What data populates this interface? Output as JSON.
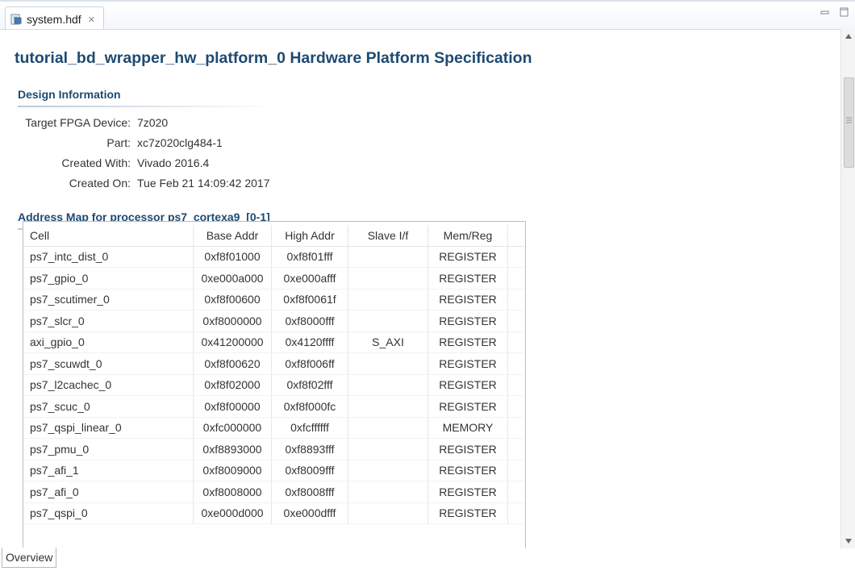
{
  "tab": {
    "filename": "system.hdf",
    "close_glyph": "✕"
  },
  "page": {
    "title": "tutorial_bd_wrapper_hw_platform_0 Hardware Platform Specification"
  },
  "design_info": {
    "heading": "Design Information",
    "rows": [
      {
        "label": "Target FPGA Device:",
        "value": "7z020"
      },
      {
        "label": "Part:",
        "value": "xc7z020clg484-1"
      },
      {
        "label": "Created With:",
        "value": "Vivado 2016.4"
      },
      {
        "label": "Created On:",
        "value": "Tue Feb 21 14:09:42 2017"
      }
    ]
  },
  "address_map": {
    "heading": "Address Map for processor ps7_cortexa9_[0-1]",
    "columns": {
      "cell": "Cell",
      "base": "Base Addr",
      "high": "High Addr",
      "slave": "Slave I/f",
      "mem": "Mem/Reg"
    },
    "rows": [
      {
        "cell": "ps7_intc_dist_0",
        "base": "0xf8f01000",
        "high": "0xf8f01fff",
        "slave": "",
        "mem": "REGISTER"
      },
      {
        "cell": "ps7_gpio_0",
        "base": "0xe000a000",
        "high": "0xe000afff",
        "slave": "",
        "mem": "REGISTER"
      },
      {
        "cell": "ps7_scutimer_0",
        "base": "0xf8f00600",
        "high": "0xf8f0061f",
        "slave": "",
        "mem": "REGISTER"
      },
      {
        "cell": "ps7_slcr_0",
        "base": "0xf8000000",
        "high": "0xf8000fff",
        "slave": "",
        "mem": "REGISTER"
      },
      {
        "cell": "axi_gpio_0",
        "base": "0x41200000",
        "high": "0x4120ffff",
        "slave": "S_AXI",
        "mem": "REGISTER"
      },
      {
        "cell": "ps7_scuwdt_0",
        "base": "0xf8f00620",
        "high": "0xf8f006ff",
        "slave": "",
        "mem": "REGISTER"
      },
      {
        "cell": "ps7_l2cachec_0",
        "base": "0xf8f02000",
        "high": "0xf8f02fff",
        "slave": "",
        "mem": "REGISTER"
      },
      {
        "cell": "ps7_scuc_0",
        "base": "0xf8f00000",
        "high": "0xf8f000fc",
        "slave": "",
        "mem": "REGISTER"
      },
      {
        "cell": "ps7_qspi_linear_0",
        "base": "0xfc000000",
        "high": "0xfcffffff",
        "slave": "",
        "mem": "MEMORY"
      },
      {
        "cell": "ps7_pmu_0",
        "base": "0xf8893000",
        "high": "0xf8893fff",
        "slave": "",
        "mem": "REGISTER"
      },
      {
        "cell": "ps7_afi_1",
        "base": "0xf8009000",
        "high": "0xf8009fff",
        "slave": "",
        "mem": "REGISTER"
      },
      {
        "cell": "ps7_afi_0",
        "base": "0xf8008000",
        "high": "0xf8008fff",
        "slave": "",
        "mem": "REGISTER"
      },
      {
        "cell": "ps7_qspi_0",
        "base": "0xe000d000",
        "high": "0xe000dfff",
        "slave": "",
        "mem": "REGISTER"
      }
    ]
  },
  "bottom_tabs": {
    "overview": "Overview"
  },
  "icons": {
    "file": "hdf-file-icon",
    "minimize": "minimize-icon",
    "maximize": "maximize-icon",
    "scroll_up": "scroll-up-arrow-icon",
    "scroll_down": "scroll-down-arrow-icon"
  },
  "colors": {
    "heading": "#1e4a72"
  }
}
